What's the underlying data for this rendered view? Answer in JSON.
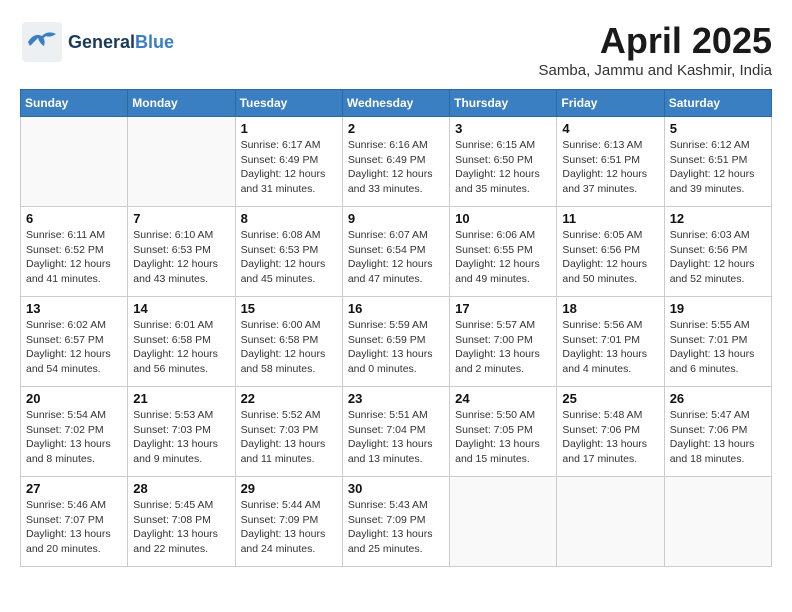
{
  "header": {
    "logo_general": "General",
    "logo_blue": "Blue",
    "month_title": "April 2025",
    "subtitle": "Samba, Jammu and Kashmir, India"
  },
  "days_of_week": [
    "Sunday",
    "Monday",
    "Tuesday",
    "Wednesday",
    "Thursday",
    "Friday",
    "Saturday"
  ],
  "weeks": [
    [
      {
        "day": "",
        "info": ""
      },
      {
        "day": "",
        "info": ""
      },
      {
        "day": "1",
        "info": "Sunrise: 6:17 AM\nSunset: 6:49 PM\nDaylight: 12 hours\nand 31 minutes."
      },
      {
        "day": "2",
        "info": "Sunrise: 6:16 AM\nSunset: 6:49 PM\nDaylight: 12 hours\nand 33 minutes."
      },
      {
        "day": "3",
        "info": "Sunrise: 6:15 AM\nSunset: 6:50 PM\nDaylight: 12 hours\nand 35 minutes."
      },
      {
        "day": "4",
        "info": "Sunrise: 6:13 AM\nSunset: 6:51 PM\nDaylight: 12 hours\nand 37 minutes."
      },
      {
        "day": "5",
        "info": "Sunrise: 6:12 AM\nSunset: 6:51 PM\nDaylight: 12 hours\nand 39 minutes."
      }
    ],
    [
      {
        "day": "6",
        "info": "Sunrise: 6:11 AM\nSunset: 6:52 PM\nDaylight: 12 hours\nand 41 minutes."
      },
      {
        "day": "7",
        "info": "Sunrise: 6:10 AM\nSunset: 6:53 PM\nDaylight: 12 hours\nand 43 minutes."
      },
      {
        "day": "8",
        "info": "Sunrise: 6:08 AM\nSunset: 6:53 PM\nDaylight: 12 hours\nand 45 minutes."
      },
      {
        "day": "9",
        "info": "Sunrise: 6:07 AM\nSunset: 6:54 PM\nDaylight: 12 hours\nand 47 minutes."
      },
      {
        "day": "10",
        "info": "Sunrise: 6:06 AM\nSunset: 6:55 PM\nDaylight: 12 hours\nand 49 minutes."
      },
      {
        "day": "11",
        "info": "Sunrise: 6:05 AM\nSunset: 6:56 PM\nDaylight: 12 hours\nand 50 minutes."
      },
      {
        "day": "12",
        "info": "Sunrise: 6:03 AM\nSunset: 6:56 PM\nDaylight: 12 hours\nand 52 minutes."
      }
    ],
    [
      {
        "day": "13",
        "info": "Sunrise: 6:02 AM\nSunset: 6:57 PM\nDaylight: 12 hours\nand 54 minutes."
      },
      {
        "day": "14",
        "info": "Sunrise: 6:01 AM\nSunset: 6:58 PM\nDaylight: 12 hours\nand 56 minutes."
      },
      {
        "day": "15",
        "info": "Sunrise: 6:00 AM\nSunset: 6:58 PM\nDaylight: 12 hours\nand 58 minutes."
      },
      {
        "day": "16",
        "info": "Sunrise: 5:59 AM\nSunset: 6:59 PM\nDaylight: 13 hours\nand 0 minutes."
      },
      {
        "day": "17",
        "info": "Sunrise: 5:57 AM\nSunset: 7:00 PM\nDaylight: 13 hours\nand 2 minutes."
      },
      {
        "day": "18",
        "info": "Sunrise: 5:56 AM\nSunset: 7:01 PM\nDaylight: 13 hours\nand 4 minutes."
      },
      {
        "day": "19",
        "info": "Sunrise: 5:55 AM\nSunset: 7:01 PM\nDaylight: 13 hours\nand 6 minutes."
      }
    ],
    [
      {
        "day": "20",
        "info": "Sunrise: 5:54 AM\nSunset: 7:02 PM\nDaylight: 13 hours\nand 8 minutes."
      },
      {
        "day": "21",
        "info": "Sunrise: 5:53 AM\nSunset: 7:03 PM\nDaylight: 13 hours\nand 9 minutes."
      },
      {
        "day": "22",
        "info": "Sunrise: 5:52 AM\nSunset: 7:03 PM\nDaylight: 13 hours\nand 11 minutes."
      },
      {
        "day": "23",
        "info": "Sunrise: 5:51 AM\nSunset: 7:04 PM\nDaylight: 13 hours\nand 13 minutes."
      },
      {
        "day": "24",
        "info": "Sunrise: 5:50 AM\nSunset: 7:05 PM\nDaylight: 13 hours\nand 15 minutes."
      },
      {
        "day": "25",
        "info": "Sunrise: 5:48 AM\nSunset: 7:06 PM\nDaylight: 13 hours\nand 17 minutes."
      },
      {
        "day": "26",
        "info": "Sunrise: 5:47 AM\nSunset: 7:06 PM\nDaylight: 13 hours\nand 18 minutes."
      }
    ],
    [
      {
        "day": "27",
        "info": "Sunrise: 5:46 AM\nSunset: 7:07 PM\nDaylight: 13 hours\nand 20 minutes."
      },
      {
        "day": "28",
        "info": "Sunrise: 5:45 AM\nSunset: 7:08 PM\nDaylight: 13 hours\nand 22 minutes."
      },
      {
        "day": "29",
        "info": "Sunrise: 5:44 AM\nSunset: 7:09 PM\nDaylight: 13 hours\nand 24 minutes."
      },
      {
        "day": "30",
        "info": "Sunrise: 5:43 AM\nSunset: 7:09 PM\nDaylight: 13 hours\nand 25 minutes."
      },
      {
        "day": "",
        "info": ""
      },
      {
        "day": "",
        "info": ""
      },
      {
        "day": "",
        "info": ""
      }
    ]
  ]
}
